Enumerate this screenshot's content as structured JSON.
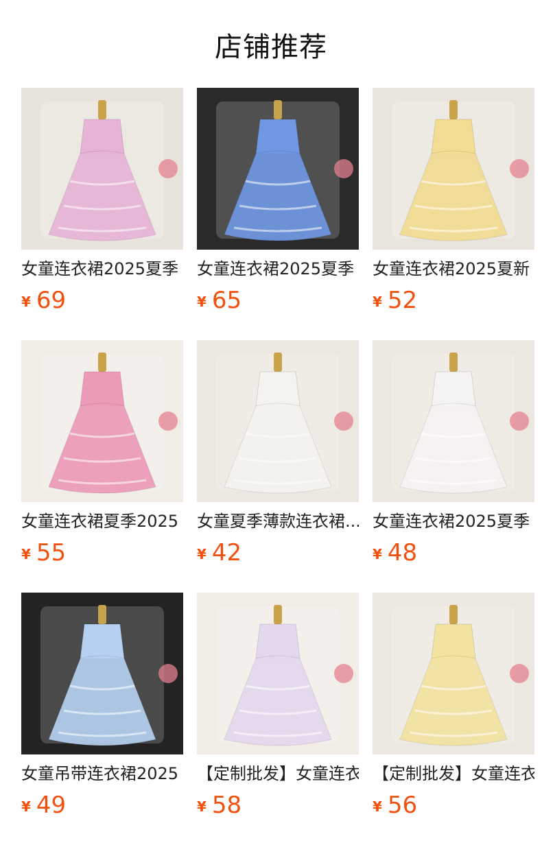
{
  "section": {
    "title": "店铺推荐"
  },
  "currency_symbol": "¥",
  "products": [
    {
      "name": "女童连衣裙2025夏季",
      "price": "69",
      "dress_color": "#e7b3d7",
      "bg_color": "#e8e3dc"
    },
    {
      "name": "女童连衣裙2025夏季",
      "price": "65",
      "dress_color": "#6f97e2",
      "bg_color": "#2a2a2a"
    },
    {
      "name": "女童连衣裙2025夏新",
      "price": "52",
      "dress_color": "#f3dd92",
      "bg_color": "#e9e4dd"
    },
    {
      "name": "女童连衣裙夏季2025",
      "price": "55",
      "dress_color": "#ec9ab8",
      "bg_color": "#f1ece6"
    },
    {
      "name": "女童夏季薄款连衣裙...",
      "price": "42",
      "dress_color": "#f5f3ef",
      "bg_color": "#ece7e0"
    },
    {
      "name": "女童连衣裙2025夏季",
      "price": "48",
      "dress_color": "#f6f3f3",
      "bg_color": "#ece7e0"
    },
    {
      "name": "女童吊带连衣裙2025",
      "price": "49",
      "dress_color": "#b5d0f0",
      "bg_color": "#232323"
    },
    {
      "name": "【定制批发】女童连衣",
      "price": "58",
      "dress_color": "#e3d8ee",
      "bg_color": "#f1ece6"
    },
    {
      "name": "【定制批发】女童连衣",
      "price": "56",
      "dress_color": "#f2e3a1",
      "bg_color": "#ece7e0"
    }
  ]
}
